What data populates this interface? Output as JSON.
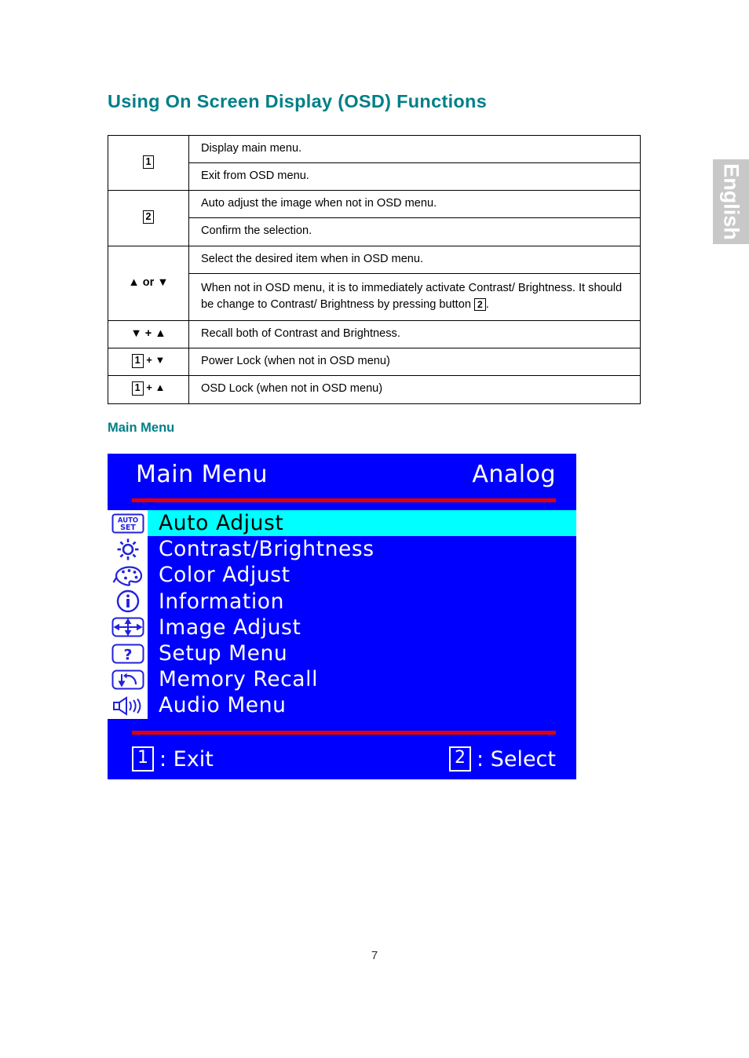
{
  "language_tab": {
    "label": "English"
  },
  "page": {
    "title": "Using On Screen Display (OSD) Functions",
    "sub_heading": "Main Menu",
    "page_number": "7",
    "title_color": "#007f87"
  },
  "key_table": {
    "rows": [
      {
        "key_prefix": "",
        "key_boxed": "1",
        "key_suffix": "",
        "description": "Display main menu.",
        "rowspan": 2,
        "first_of_group": true
      },
      {
        "key_prefix": "",
        "key_boxed": "",
        "key_suffix": "",
        "description": "Exit from OSD menu.",
        "first_of_group": false
      },
      {
        "key_prefix": "",
        "key_boxed": "2",
        "key_suffix": "",
        "description": "Auto adjust the image when not in OSD menu.",
        "rowspan": 2,
        "first_of_group": true
      },
      {
        "key_prefix": "",
        "key_boxed": "",
        "key_suffix": "",
        "description": "Confirm the selection.",
        "first_of_group": false
      },
      {
        "key_prefix": "▲ or ▼",
        "key_boxed": "",
        "key_suffix": "",
        "description": "Select the desired item when in OSD menu.",
        "rowspan": 2,
        "first_of_group": true
      },
      {
        "key_prefix": "",
        "key_boxed": "",
        "key_suffix": "",
        "description_part1": "When not in OSD menu, it is to immediately activate Contrast/ Brightness. It should be change to Contrast/ Brightness by pressing button ",
        "description_boxed": "2",
        "description_part2": ".",
        "first_of_group": false
      },
      {
        "key_prefix": "▼ + ▲",
        "key_boxed": "",
        "key_suffix": "",
        "description": "Recall both of Contrast and Brightness."
      },
      {
        "key_prefix": "",
        "key_boxed": "1",
        "key_suffix": " + ▼",
        "description": "Power Lock (when not in OSD menu)"
      },
      {
        "key_prefix": "",
        "key_boxed": "1",
        "key_suffix": " + ▲",
        "description": "OSD Lock (when not in OSD menu)"
      }
    ]
  },
  "osd": {
    "title": "Main Menu",
    "source": "Analog",
    "background_color": "#0000ff",
    "rule_color": "#e00000",
    "highlight_color": "#00ffff",
    "icon_color": "#2222dd",
    "items": [
      {
        "label": "Auto Adjust",
        "icon": "auto-set-icon",
        "selected": true
      },
      {
        "label": "Contrast/Brightness",
        "icon": "brightness-sun-icon",
        "selected": false
      },
      {
        "label": "Color Adjust",
        "icon": "color-palette-icon",
        "selected": false
      },
      {
        "label": "Information",
        "icon": "info-circle-icon",
        "selected": false
      },
      {
        "label": "Image Adjust",
        "icon": "four-arrows-icon",
        "selected": false
      },
      {
        "label": "Setup Menu",
        "icon": "question-mark-icon",
        "selected": false
      },
      {
        "label": "Memory Recall",
        "icon": "memory-recall-icon",
        "selected": false
      },
      {
        "label": "Audio Menu",
        "icon": "speaker-icon",
        "selected": false
      }
    ],
    "footer": {
      "left_button": "1",
      "left_label": ": Exit",
      "right_button": "2",
      "right_label": ": Select"
    },
    "icon_labels": {
      "auto_set_line1": "AUTO",
      "auto_set_line2": "SET"
    }
  }
}
